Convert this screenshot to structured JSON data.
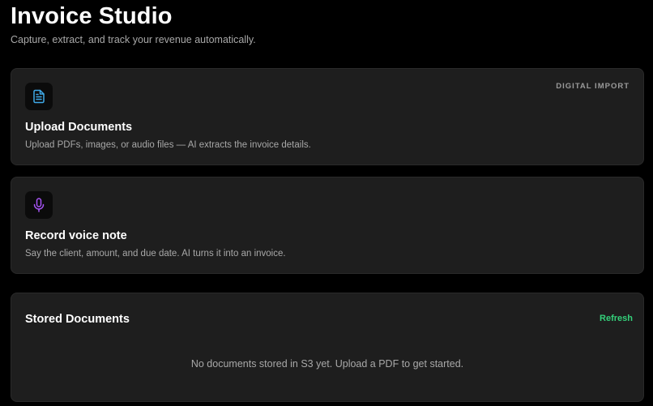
{
  "header": {
    "title": "Invoice Studio",
    "subtitle": "Capture, extract, and track your revenue automatically."
  },
  "upload_card": {
    "icon": "document-icon",
    "icon_color": "#3fa9e8",
    "badge": "DIGITAL IMPORT",
    "title": "Upload Documents",
    "description": "Upload PDFs, images, or audio files — AI extracts the invoice details."
  },
  "voice_card": {
    "icon": "microphone-icon",
    "icon_color": "#a855f7",
    "title": "Record voice note",
    "description": "Say the client, amount, and due date. AI turns it into an invoice."
  },
  "stored_documents": {
    "title": "Stored Documents",
    "refresh_label": "Refresh",
    "refresh_color": "#34d07a",
    "empty_message": "No documents stored in S3 yet. Upload a PDF to get started."
  }
}
